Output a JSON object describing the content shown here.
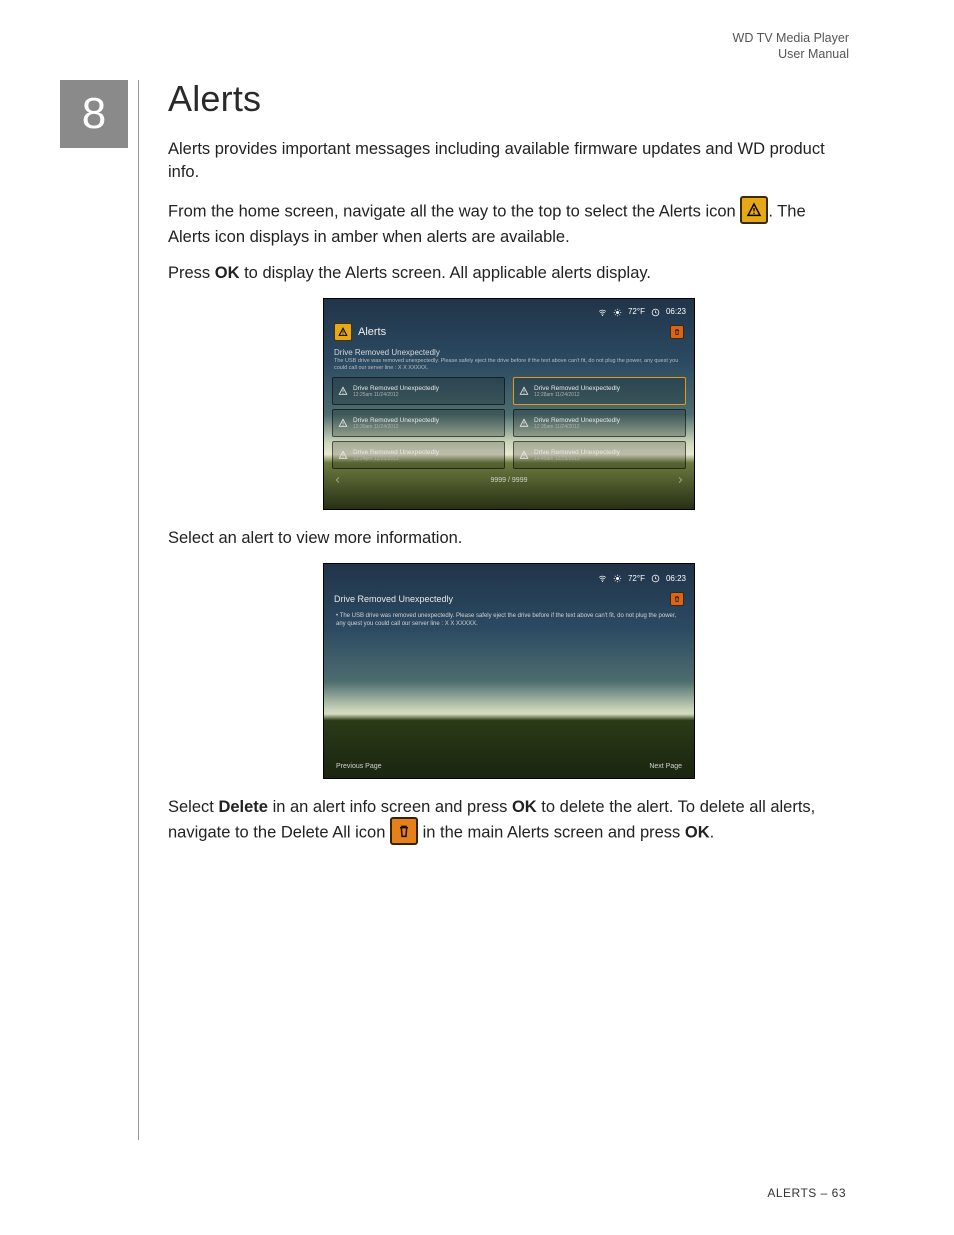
{
  "header": {
    "product": "WD TV Media Player",
    "doc": "User Manual"
  },
  "chapter_number": "8",
  "title": "Alerts",
  "para1": "Alerts provides important messages including available firmware updates and WD product info.",
  "para2a": "From the home screen, navigate all the way to the top to select the Alerts icon ",
  "para2b": ". The Alerts icon displays in amber when alerts are available.",
  "para3_pre": "Press ",
  "para3_bold": "OK",
  "para3_post": " to display the Alerts screen. All applicable alerts display.",
  "para4": "Select an alert to view more information.",
  "para5_a": "Select ",
  "para5_b_bold": "Delete",
  "para5_c": " in an alert info screen and press ",
  "para5_d_bold": "OK",
  "para5_e": " to delete the alert. To delete all alerts, navigate to the Delete All icon ",
  "para5_f": " in the main Alerts screen and press ",
  "para5_g_bold": "OK",
  "para5_h": ".",
  "footer": {
    "section": "ALERTS",
    "sep": " – ",
    "page": "63"
  },
  "ss_common": {
    "temp": "72°F",
    "time": "06:23",
    "alerts_title": "Alerts",
    "alert_heading": "Drive Removed Unexpectedly",
    "alert_body": "The USB drive was removed unexpectedly.  Please safely eject the drive before if the text above can't fit, do not plug the power, any quest you could call our server line : X X XXXXX.",
    "pager": "9999 / 9999"
  },
  "ss1_items": [
    {
      "title": "Drive Removed Unexpectedly",
      "ts": "12:25am  11/24/2012"
    },
    {
      "title": "Drive Removed Unexpectedly",
      "ts": "12:28am  11/24/2012",
      "selected": true
    },
    {
      "title": "Drive Removed Unexpectedly",
      "ts": "12:30am  11/24/2012"
    },
    {
      "title": "Drive Removed Unexpectedly",
      "ts": "12:35am  11/24/2012"
    },
    {
      "title": "Drive Removed Unexpectedly",
      "ts": "13:24pm  12/31/2012"
    },
    {
      "title": "Drive Removed Unexpectedly",
      "ts": "14:45am  12/25/2012"
    }
  ],
  "ss2": {
    "heading": "Drive Removed Unexpectedly",
    "bullet": "The USB drive was removed unexpectedly.  Please safely eject the drive before if the text above can't fit, do not plug the power, any quest you could call our server line : X X XXXXX.",
    "prev": "Previous Page",
    "next": "Next Page"
  }
}
